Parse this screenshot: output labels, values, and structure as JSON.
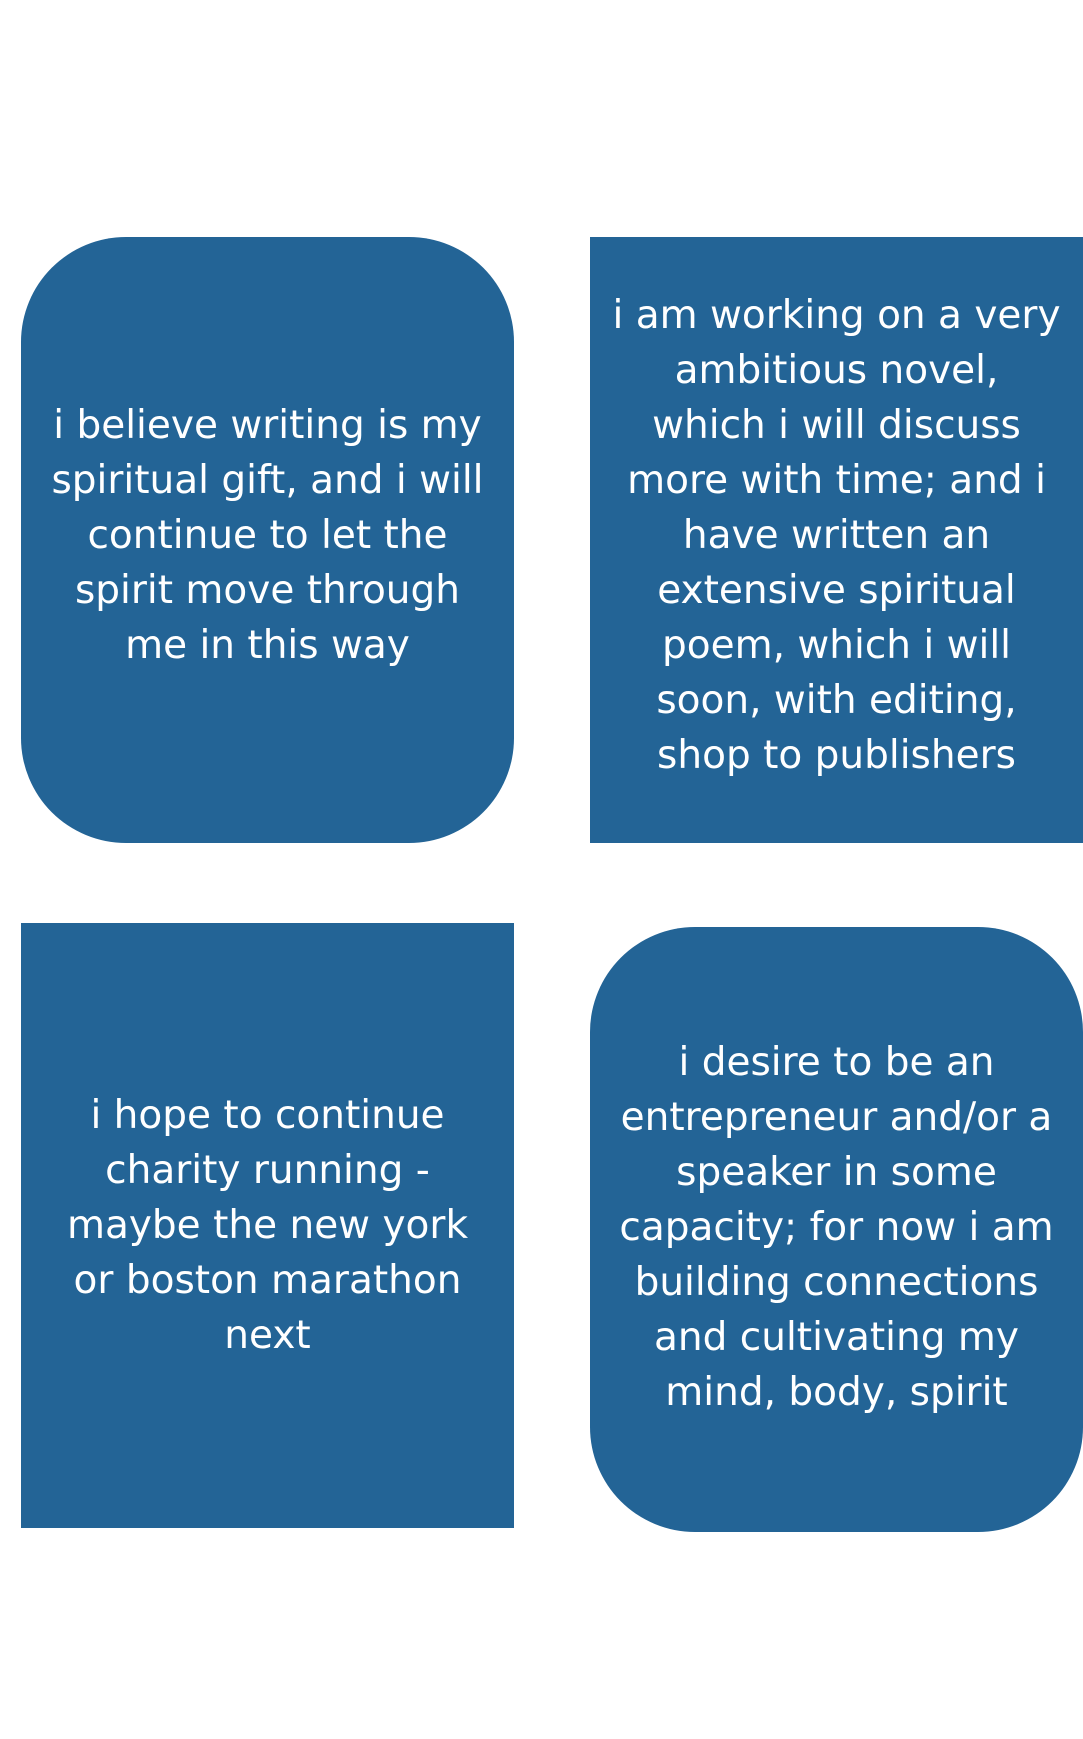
{
  "colors": {
    "card": "#236496",
    "text": "#ffffff",
    "background": "#ffffff"
  },
  "cards": [
    {
      "text": "i believe writing is my\nspiritual gift, and i will\ncontinue to let the\nspirit move through\nme in this way"
    },
    {
      "text": "i am working on a very\nambitious novel,\nwhich i will discuss\nmore with time; and i\nhave written an\nextensive spiritual\npoem, which i will\nsoon, with editing,\nshop to publishers"
    },
    {
      "text": "i hope to continue\ncharity running -\nmaybe the new york\nor boston marathon\nnext"
    },
    {
      "text": "i desire to be an\nentrepreneur and/or a\nspeaker in some\ncapacity; for now i am\nbuilding connections\nand cultivating my\nmind, body, spirit"
    }
  ]
}
